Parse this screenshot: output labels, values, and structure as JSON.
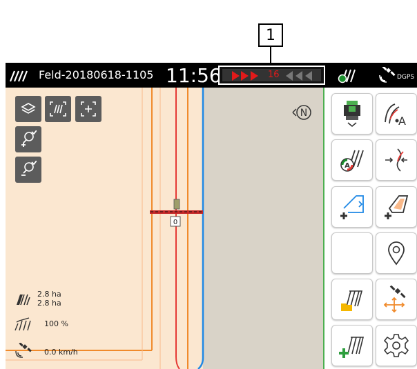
{
  "callout": {
    "number": "1"
  },
  "topbar": {
    "field_name": "Feld-20180618-1105",
    "time": "11:56",
    "lightbar": {
      "deviation": "16",
      "deviation_color": "#e21a1a"
    },
    "gps_label": "DGPS"
  },
  "map": {
    "background_color": "#fbe7d0",
    "unworked_color": "#d9d3c8",
    "north_label": "N",
    "implement_section_label": "0",
    "controls": [
      "layers-icon",
      "zoom-field-icon",
      "center-view-icon",
      "zoom-in-icon",
      "zoom-out-icon"
    ]
  },
  "stats": {
    "area_total": "2.8 ha",
    "area_worked": "2.8 ha",
    "section_width": "100 %",
    "speed": "0.0 km/h"
  },
  "panel": {
    "accent_color": "#4caf50",
    "buttons": [
      "tractor-icon",
      "guidance-line-a-icon",
      "field-overlay-icon",
      "segment-icon",
      "add-field-boundary-icon",
      "add-obstacle-boundary-icon",
      "empty",
      "location-pin-icon",
      "open-field-icon",
      "gps-satellite-icon",
      "new-field-icon",
      "settings-icon"
    ]
  }
}
